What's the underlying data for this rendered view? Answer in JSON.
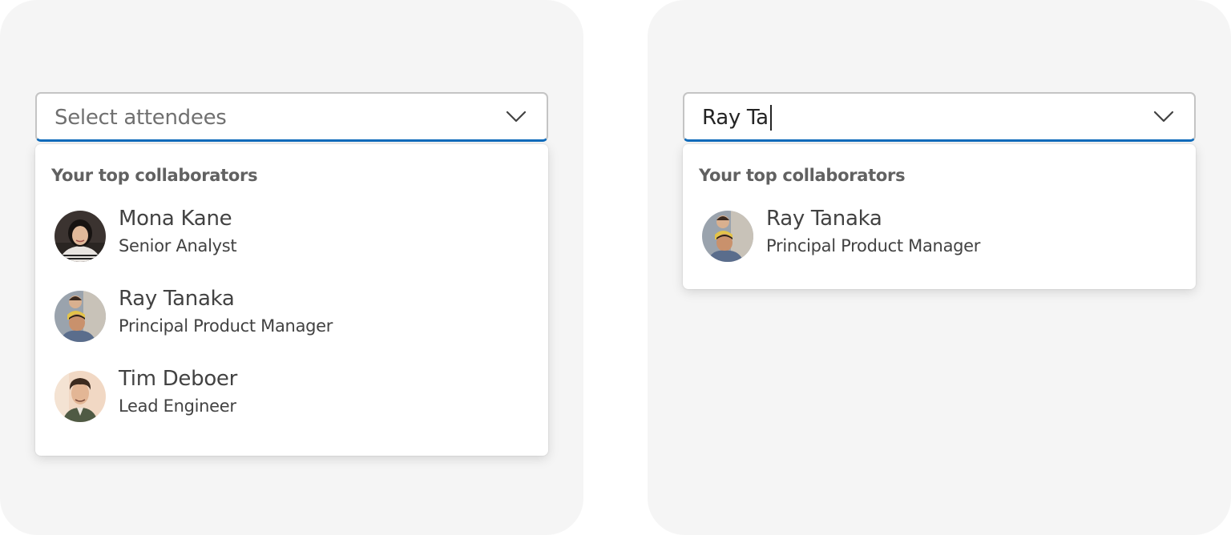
{
  "left_panel": {
    "combobox": {
      "placeholder": "Select attendees",
      "value": ""
    },
    "listbox": {
      "group_label": "Your top collaborators",
      "options": [
        {
          "name": "Mona Kane",
          "title": "Senior Analyst",
          "avatar": "photo-woman-dark-hair"
        },
        {
          "name": "Ray Tanaka",
          "title": "Principal Product Manager",
          "avatar": "photo-man-with-child"
        },
        {
          "name": "Tim Deboer",
          "title": "Lead Engineer",
          "avatar": "photo-man-curly-hair"
        }
      ]
    }
  },
  "right_panel": {
    "combobox": {
      "placeholder": "",
      "value": "Ray Ta"
    },
    "listbox": {
      "group_label": "Your top collaborators",
      "options": [
        {
          "name": "Ray Tanaka",
          "title": "Principal Product Manager",
          "avatar": "photo-man-with-child"
        }
      ]
    }
  },
  "icons": {
    "dropdown": "chevron-down-icon"
  },
  "colors": {
    "panel_background": "#f5f5f5",
    "focus_underline": "#0f6cbd",
    "input_border": "#c4c4c4",
    "placeholder_text": "#707070",
    "primary_text": "#242424",
    "secondary_text": "#424242",
    "group_header_text": "#616161"
  }
}
